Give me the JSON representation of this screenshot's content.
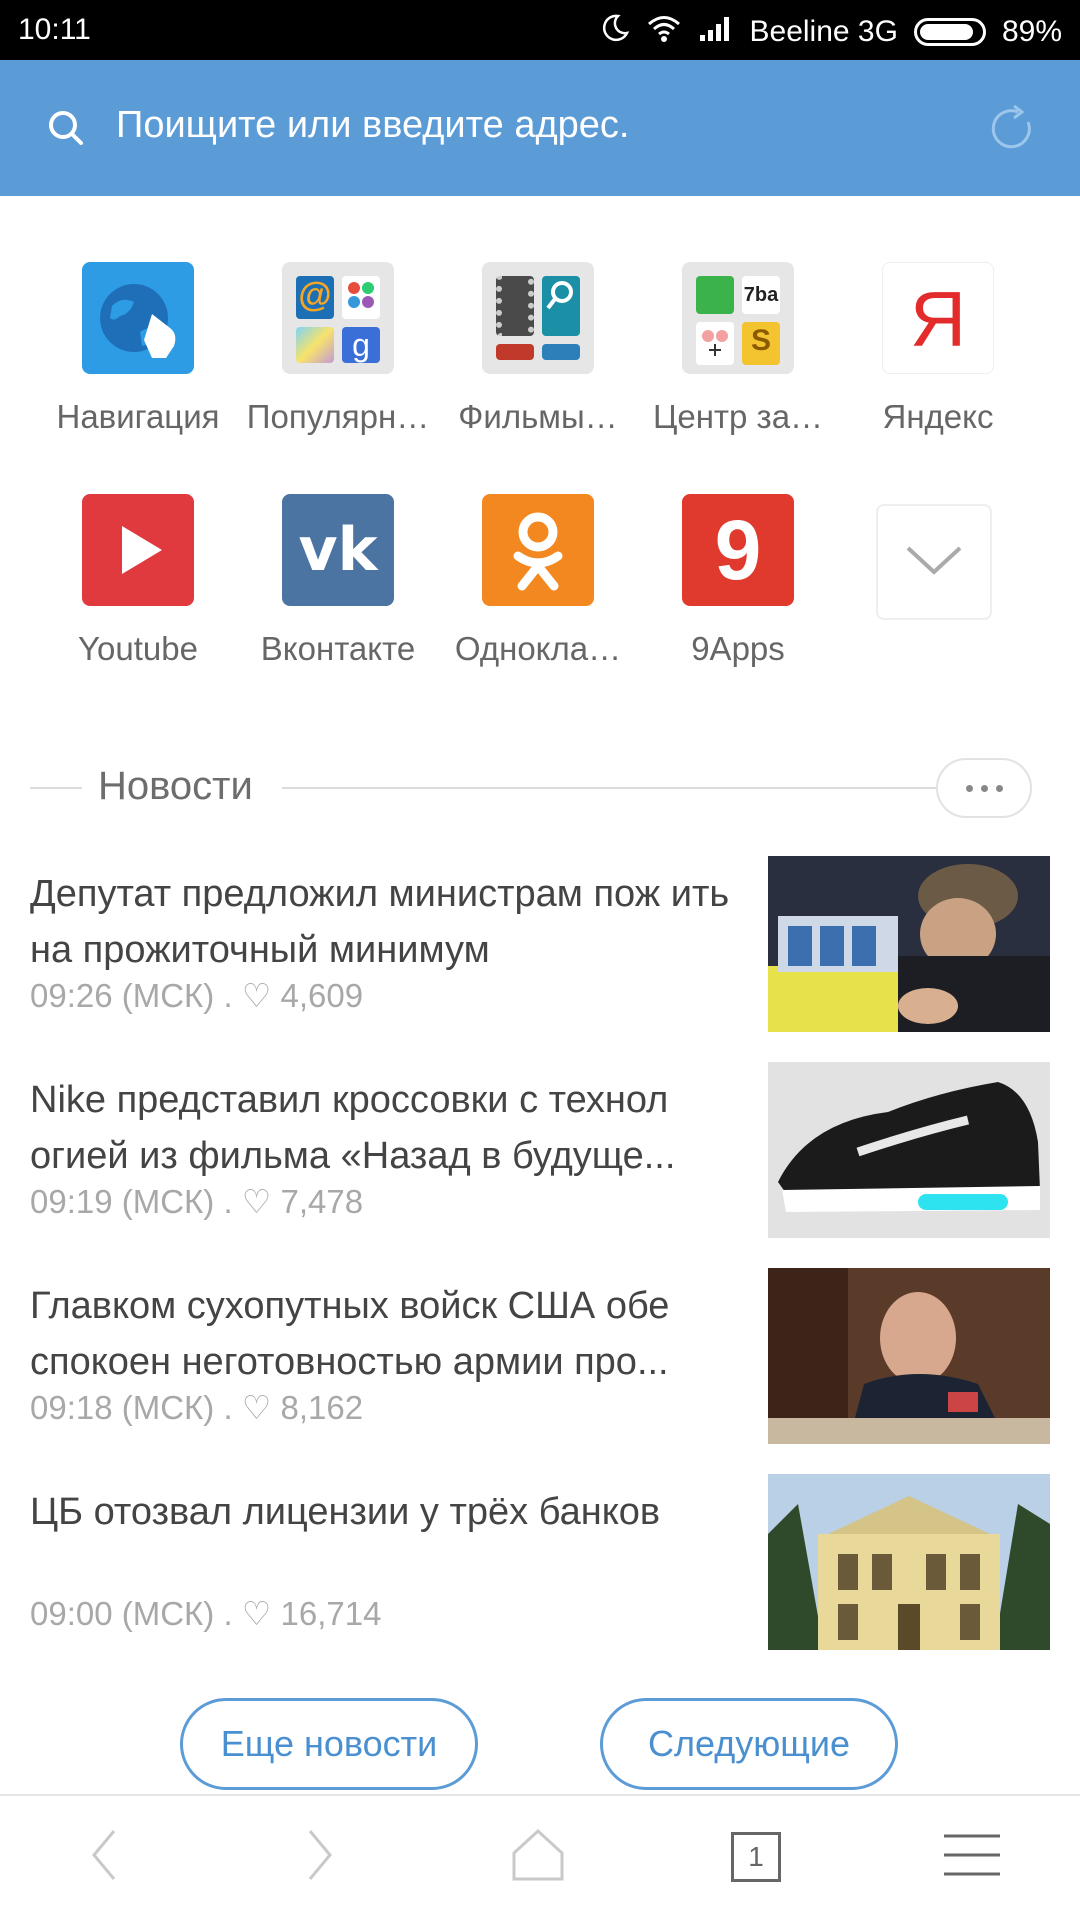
{
  "status_bar": {
    "time": "10:11",
    "carrier": "Beeline 3G",
    "battery": "89%",
    "battery_level": 0.89
  },
  "search": {
    "placeholder": "Поищите или введите адрес."
  },
  "speed_dial": [
    {
      "label": "Навигация",
      "icon": "globe-hand-icon",
      "color": "#2e9be5"
    },
    {
      "label": "Популярн…",
      "icon": "popular-folder-icon"
    },
    {
      "label": "Фильмы…",
      "icon": "movies-folder-icon"
    },
    {
      "label": "Центр за…",
      "icon": "downloads-folder-icon"
    },
    {
      "label": "Яндекс",
      "icon": "yandex-icon",
      "glyph": "Я",
      "color": "#e32b2b"
    },
    {
      "label": "Youtube",
      "icon": "youtube-icon",
      "color": "#e03a3e"
    },
    {
      "label": "Вконтакте",
      "icon": "vk-icon",
      "glyph": "vk",
      "color": "#4b74a3"
    },
    {
      "label": "Однокла…",
      "icon": "odnoklassniki-icon",
      "color": "#f2881f"
    },
    {
      "label": "9Apps",
      "icon": "9apps-icon",
      "glyph": "9",
      "color": "#e03a2e"
    }
  ],
  "folder_glyphs": {
    "mail": "@",
    "seven_ba": "7ba",
    "s": "S",
    "g": "g"
  },
  "news": {
    "title": "Новости",
    "items": [
      {
        "headline": "Депутат предложил министрам пож ить на прожиточный минимум",
        "meta": "09:26 (МСК) . ♡ 4,609",
        "thumb": "man-counting-coins-image"
      },
      {
        "headline": "Nike представил кроссовки с технол огией из фильма «Назад в будуще...",
        "meta": "09:19 (МСК) . ♡ 7,478",
        "thumb": "black-sneaker-image"
      },
      {
        "headline": "Главком сухопутных войск США обе спокоен неготовностью армии про...",
        "meta": "09:18 (МСК) . ♡ 8,162",
        "thumb": "general-speaking-image"
      },
      {
        "headline": "ЦБ отозвал лицензии у трёх банков",
        "meta": "09:00 (МСК) . ♡ 16,714",
        "thumb": "central-bank-building-image"
      }
    ]
  },
  "buttons": {
    "more_news": "Еще новости",
    "next": "Следующие"
  },
  "toolbar": {
    "tab_count": "1"
  }
}
